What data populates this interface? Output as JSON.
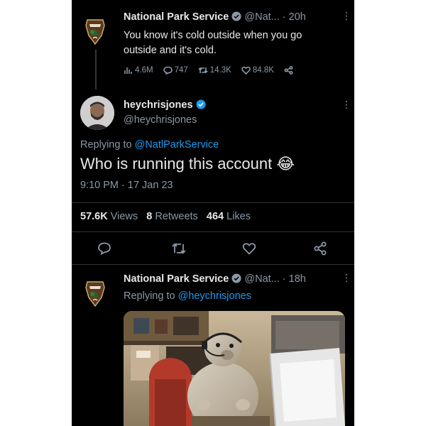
{
  "tweet1": {
    "display_name": "National Park Service",
    "handle": "@Nat...",
    "separator": "·",
    "time_ago": "20h",
    "text_line1": "You know it's cold outside when you go",
    "text_line2": "outside and it's cold.",
    "stats": {
      "views": "4.6M",
      "replies": "747",
      "retweets": "14.3K",
      "likes": "84.8K"
    }
  },
  "tweet2": {
    "display_name": "heychrisjones",
    "handle": "@heychrisjones",
    "replying_prefix": "Replying to",
    "replying_to": "@NatlParkService",
    "text": "Who is running this account",
    "emoji": "😂",
    "timestamp": "9:10 PM · 17 Jan 23",
    "views_count": "57.6K",
    "views_label": "Views",
    "retweets_count": "8",
    "retweets_label": "Retweets",
    "likes_count": "464",
    "likes_label": "Likes"
  },
  "tweet3": {
    "display_name": "National Park Service",
    "handle": "@Nat...",
    "separator": "·",
    "time_ago": "18h",
    "replying_prefix": "Replying to",
    "replying_to": "@heychrisjones",
    "media_description": "groundhog with headset at computer"
  },
  "colors": {
    "background": "#000000",
    "accent": "#1d9bf0",
    "muted": "#8b98a5",
    "text": "#e7e9ea"
  },
  "icons": [
    "nps-arrowhead-logo",
    "verified-badge-icon",
    "more-icon",
    "views-icon",
    "reply-icon",
    "retweet-icon",
    "like-icon",
    "share-icon"
  ]
}
